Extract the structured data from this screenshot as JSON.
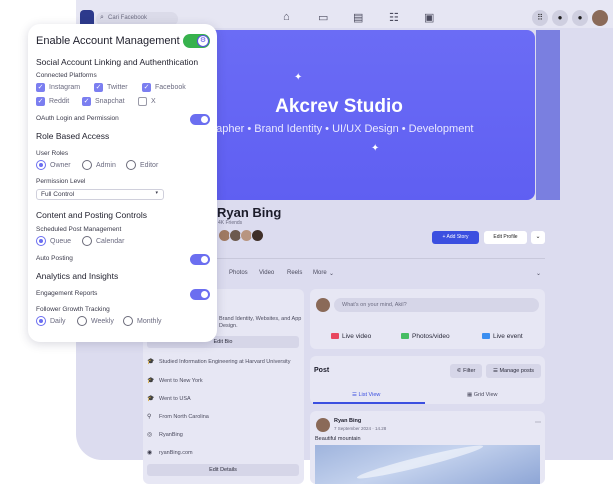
{
  "facebook": {
    "search_placeholder": "Cari Facebook",
    "cover": {
      "title": "Akcrev Studio",
      "subtitle": "rapher • Brand Identity • UI/UX Design • Development"
    },
    "profile": {
      "name": "Ryan Bing",
      "friends": "4K Friends",
      "add_story_label": "+ Add Story",
      "edit_profile_label": "Edit Profile"
    },
    "tabs": [
      "Photos",
      "Video",
      "Reels",
      "More"
    ],
    "intro": {
      "text": "Brand Identity, Websites, and App Design.",
      "edit_bio_label": "Edit Bio",
      "items": [
        "Studied Information Engineering at Harvard University",
        "Went to New York",
        "Went to USA",
        "From North Carolina",
        "RyanBing",
        "ryanBing.com"
      ],
      "edit_details_label": "Edit Details"
    },
    "composer": {
      "placeholder": "What's on your mind, Akil?",
      "live_video_label": "Live video",
      "photo_video_label": "Photos/video",
      "live_event_label": "Live event"
    },
    "posts": {
      "title": "Post",
      "filter_label": "Filter",
      "manage_label": "Manage posts",
      "list_view_label": "List View",
      "grid_view_label": "Grid View"
    },
    "feed": {
      "author": "Ryan Bing",
      "date": "7 September 2024 · 14.28",
      "caption": "Beautiful mountain"
    }
  },
  "panel": {
    "title": "Enable Account Management",
    "social_heading": "Social Account Linking and Authenthication",
    "connected_label": "Connected Platforms",
    "platforms": [
      {
        "label": "Instagram",
        "checked": true
      },
      {
        "label": "Twitter",
        "checked": true
      },
      {
        "label": "Facebook",
        "checked": true
      },
      {
        "label": "Reddit",
        "checked": true
      },
      {
        "label": "Snapchat",
        "checked": true
      },
      {
        "label": "X",
        "checked": false
      }
    ],
    "oauth_label": "OAuth Login and Permission",
    "role_heading": "Role Based Access",
    "user_roles_label": "User Roles",
    "roles": [
      {
        "label": "Owner",
        "selected": true
      },
      {
        "label": "Admin",
        "selected": false
      },
      {
        "label": "Editor",
        "selected": false
      }
    ],
    "permission_label": "Permission Level",
    "permission_value": "Full Control",
    "content_heading": "Content and Posting Controls",
    "scheduled_label": "Scheduled Post Management",
    "schedule_options": [
      {
        "label": "Queue",
        "selected": true
      },
      {
        "label": "Calendar",
        "selected": false
      }
    ],
    "auto_posting_label": "Auto Posting",
    "analytics_heading": "Analytics and Insights",
    "engagement_label": "Engagement Reports",
    "follower_label": "Follower Growth Tracking",
    "tracking_options": [
      {
        "label": "Daily",
        "selected": true
      },
      {
        "label": "Weekly",
        "selected": false
      },
      {
        "label": "Monthly",
        "selected": false
      }
    ],
    "toggles": {
      "main": true,
      "oauth": true,
      "auto_posting": true,
      "engagement": true
    }
  },
  "colors": {
    "accent": "#6b6ef0",
    "main_toggle": "#37b24d",
    "cover": "#6466f3",
    "primary_button": "#3b4fe0"
  }
}
